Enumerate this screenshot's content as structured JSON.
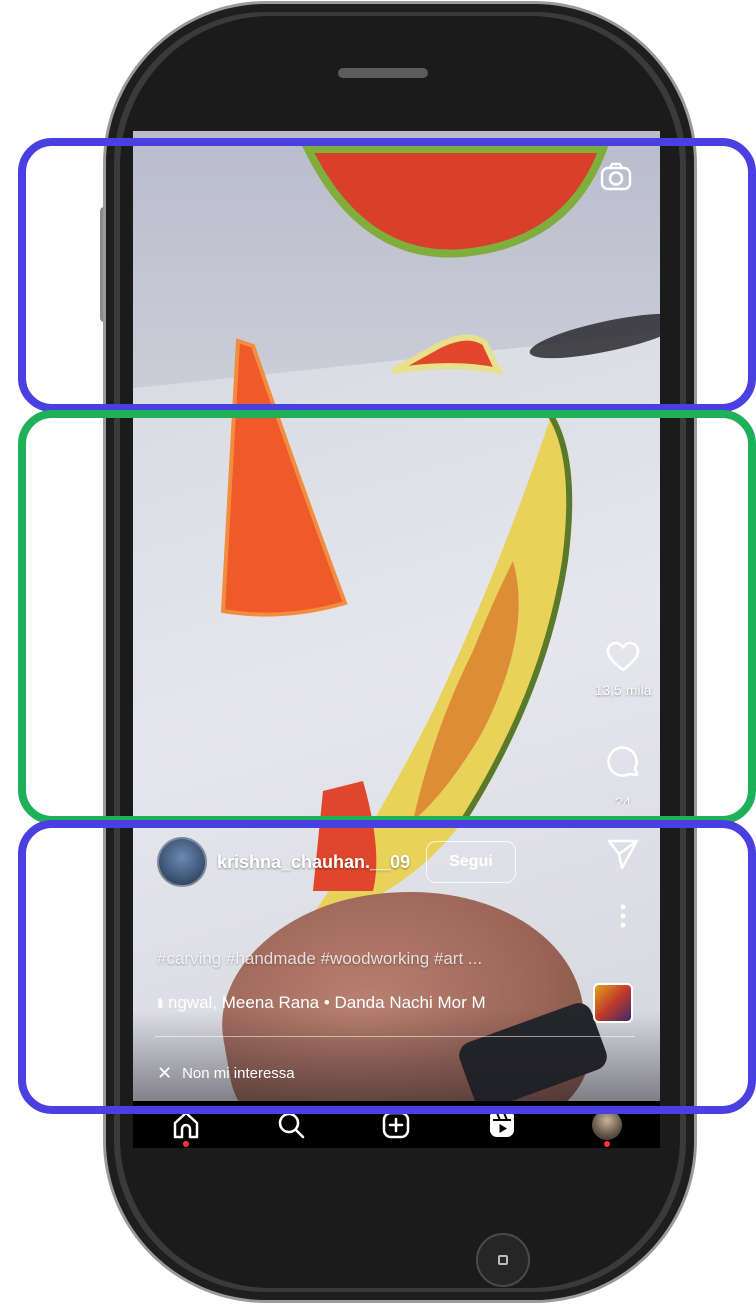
{
  "reel": {
    "likes": "13,5 mila",
    "comments": "24",
    "author": {
      "username": "krishna_chauhan.__09",
      "follow_label": "Segui"
    },
    "caption": "#carving #handmade #woodworking #art ...",
    "audio": "ngwal, Meena Rana • Danda Nachi Mor   M",
    "not_interested_label": "Non mi interessa"
  },
  "nav": {
    "items": [
      "home-icon",
      "search-icon",
      "create-icon",
      "reels-icon",
      "profile-avatar"
    ]
  },
  "colors": {
    "annotation_blue": "#4a3fe0",
    "annotation_green": "#1fb05a",
    "notification_dot": "#ff3040"
  }
}
